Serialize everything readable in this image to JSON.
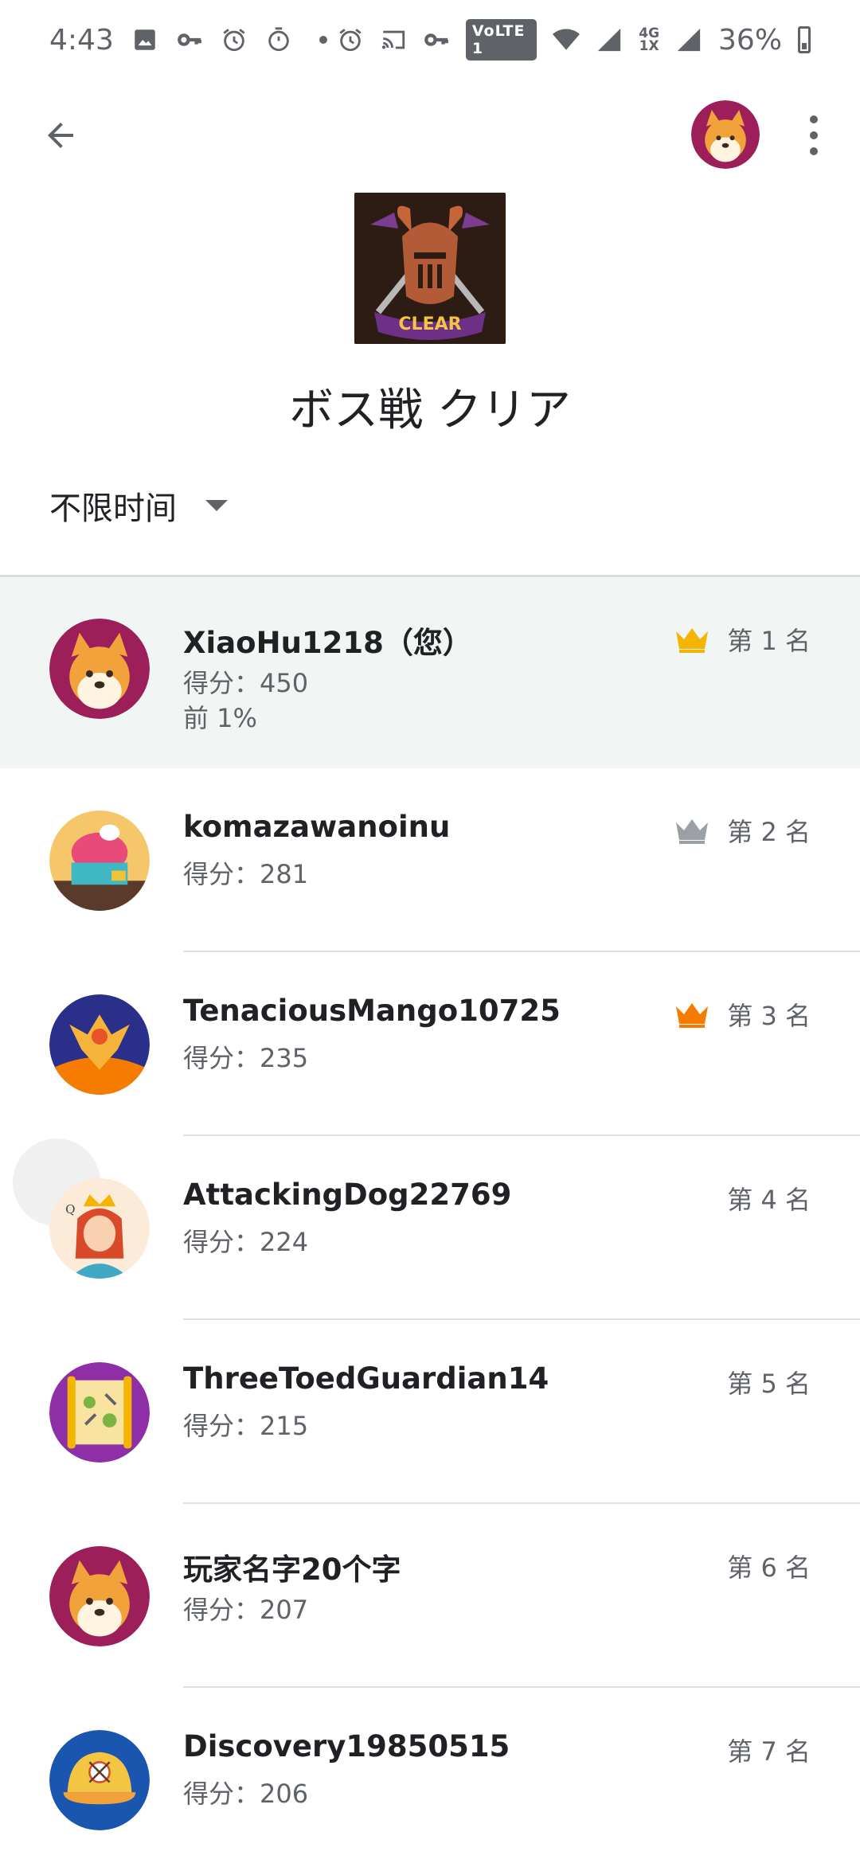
{
  "status_bar": {
    "time": "4:43",
    "volte": "VoLTE 1",
    "network_top": "4G",
    "network_bottom": "1X",
    "battery": "36%",
    "icons": [
      "image-icon",
      "key-icon",
      "alarm-icon",
      "timer-icon",
      "dot-icon",
      "alarm-icon",
      "cast-icon",
      "key-icon",
      "wifi-icon",
      "signal-icon",
      "battery-icon"
    ]
  },
  "app_bar": {
    "icons": [
      "back-arrow-icon",
      "profile-avatar",
      "more-vert-icon"
    ]
  },
  "achievement": {
    "image_label": "CLEAR",
    "title": "ボス戦 クリア"
  },
  "filter": {
    "selected": "不限时间"
  },
  "leaderboard": [
    {
      "name": "XiaoHu1218（您）",
      "score": "得分：450",
      "percentile": "前 1%",
      "rank": "第 1 名",
      "crown": "gold",
      "avatar": "shiba"
    },
    {
      "name": "komazawanoinu",
      "score": "得分：281",
      "rank": "第 2 名",
      "crown": "silver",
      "avatar": "cupcake"
    },
    {
      "name": "TenaciousMango10725",
      "score": "得分：235",
      "rank": "第 3 名",
      "crown": "bronze",
      "avatar": "phoenix"
    },
    {
      "name": "AttackingDog22769",
      "score": "得分：224",
      "rank": "第 4 名",
      "crown": "",
      "avatar": "queen"
    },
    {
      "name": "ThreeToedGuardian14",
      "score": "得分：215",
      "rank": "第 5 名",
      "crown": "",
      "avatar": "map-scroll"
    },
    {
      "name": "玩家名字20个字",
      "score": "得分：207",
      "rank": "第 6 名",
      "crown": "",
      "avatar": "shiba"
    },
    {
      "name": "Discovery19850515",
      "score": "得分：206",
      "rank": "第 7 名",
      "crown": "",
      "avatar": "baseball-cap"
    }
  ],
  "colors": {
    "highlight_row": "#f1f6f4",
    "gold": "#f4b400",
    "silver": "#9aa0a6",
    "bronze": "#f57c00",
    "text_primary": "#202124",
    "text_secondary": "#5f6368"
  }
}
